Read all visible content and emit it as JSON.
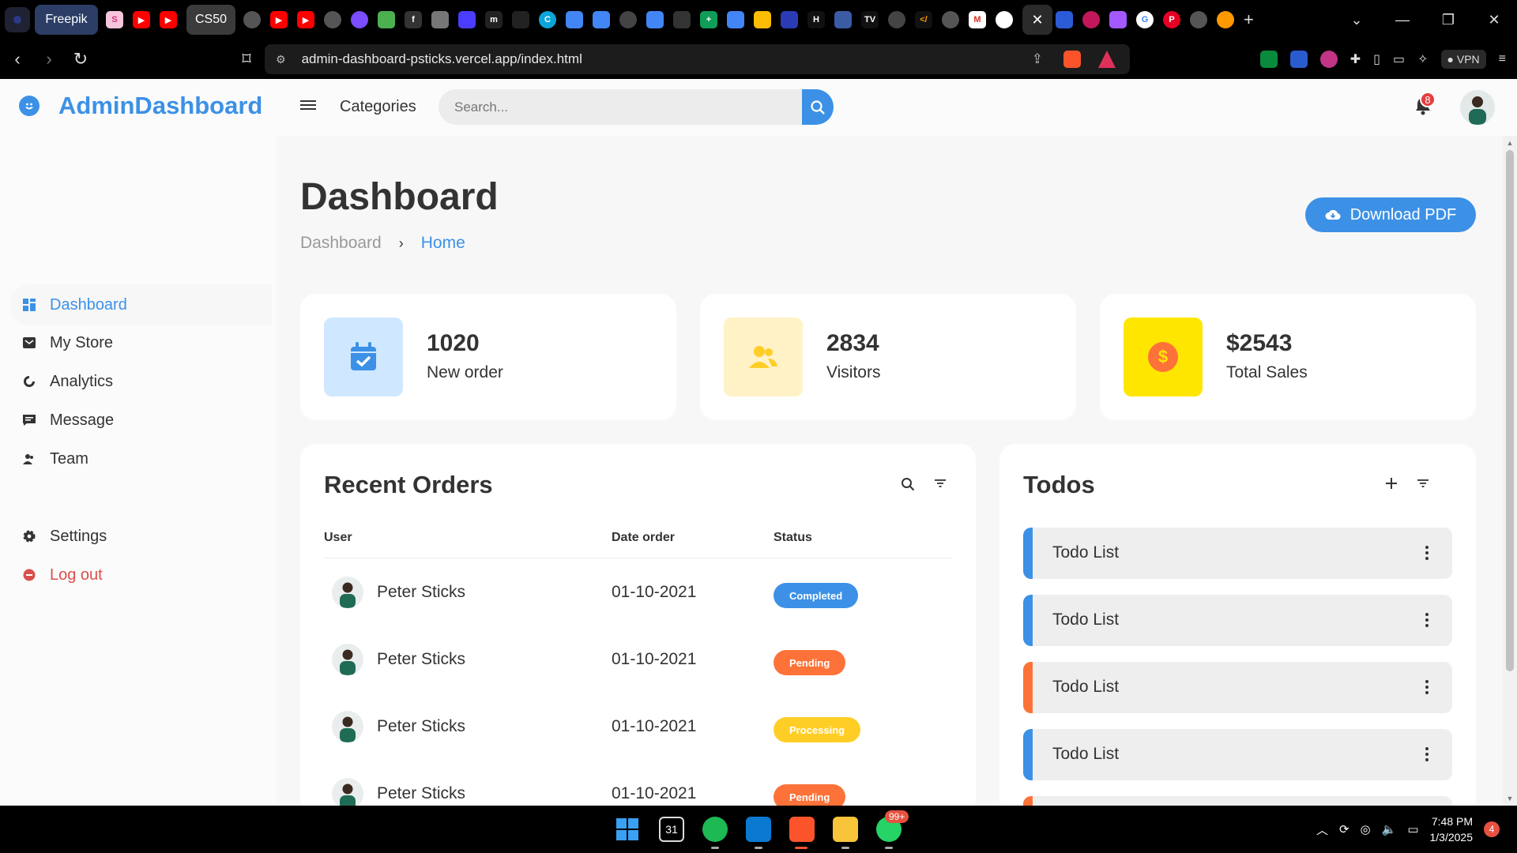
{
  "browser": {
    "tabs": [
      {
        "label": "Freepik"
      },
      {
        "label": "CS50"
      }
    ],
    "url": "admin-dashboard-psticks.vercel.app/index.html",
    "vpn_label": "VPN",
    "shield_count": "1",
    "alert_count": "1"
  },
  "app": {
    "brand": "AdminDashboard",
    "categories_label": "Categories",
    "search_placeholder": "Search...",
    "notification_count": "8"
  },
  "sidebar": {
    "items": [
      {
        "label": "Dashboard",
        "icon": "dashboard-icon",
        "active": true
      },
      {
        "label": "My Store",
        "icon": "store-icon"
      },
      {
        "label": "Analytics",
        "icon": "analytics-icon"
      },
      {
        "label": "Message",
        "icon": "message-icon"
      },
      {
        "label": "Team",
        "icon": "team-icon"
      }
    ],
    "settings_label": "Settings",
    "logout_label": "Log out"
  },
  "main": {
    "title": "Dashboard",
    "breadcrumb": [
      "Dashboard",
      "Home"
    ],
    "download_label": "Download PDF",
    "stats": [
      {
        "value": "1020",
        "label": "New order",
        "icon": "calendar-check-icon",
        "bg": "#cfe8ff",
        "fg": "#3c91e6"
      },
      {
        "value": "2834",
        "label": "Visitors",
        "icon": "people-icon",
        "bg": "#fff2c6",
        "fg": "#ffce26"
      },
      {
        "value": "$2543",
        "label": "Total Sales",
        "icon": "dollar-circle-icon",
        "bg": "#ffe0d3",
        "fg": "#fd7238"
      }
    ],
    "orders": {
      "title": "Recent Orders",
      "columns": [
        "User",
        "Date order",
        "Status"
      ],
      "rows": [
        {
          "user": "Peter Sticks",
          "date": "01-10-2021",
          "status": "Completed"
        },
        {
          "user": "Peter Sticks",
          "date": "01-10-2021",
          "status": "Pending"
        },
        {
          "user": "Peter Sticks",
          "date": "01-10-2021",
          "status": "Processing"
        },
        {
          "user": "Peter Sticks",
          "date": "01-10-2021",
          "status": "Pending"
        }
      ]
    },
    "todos": {
      "title": "Todos",
      "items": [
        {
          "label": "Todo List",
          "state": "completed",
          "color": "#3c91e6"
        },
        {
          "label": "Todo List",
          "state": "completed",
          "color": "#3c91e6"
        },
        {
          "label": "Todo List",
          "state": "not-completed",
          "color": "#fd7238"
        },
        {
          "label": "Todo List",
          "state": "completed",
          "color": "#3c91e6"
        }
      ]
    }
  },
  "taskbar": {
    "time": "7:48 PM",
    "date": "1/3/2025",
    "whatsapp_badge": "99+",
    "notification_count": "4",
    "calendar_day": "31"
  },
  "colors": {
    "accent": "#3c91e6",
    "orange": "#fd7238",
    "yellow": "#ffce26",
    "red": "#db504a"
  }
}
